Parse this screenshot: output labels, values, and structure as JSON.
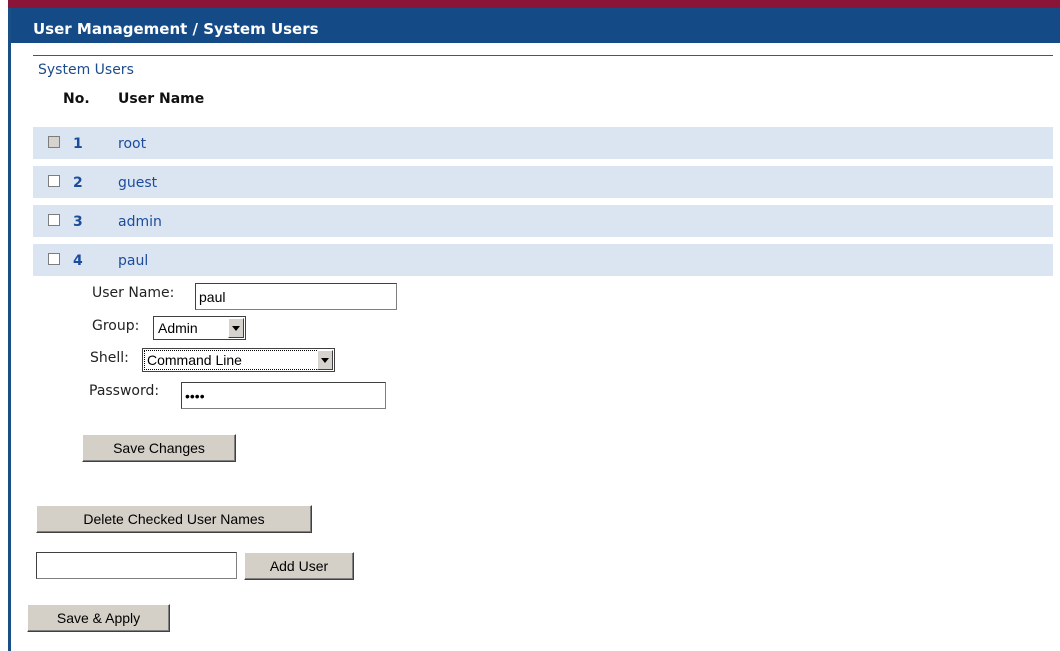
{
  "header": {
    "title": "User Management / System Users"
  },
  "section": {
    "title": "System Users"
  },
  "table": {
    "col_no": "No.",
    "col_user": "User Name",
    "rows": [
      {
        "no": "1",
        "name": "root",
        "checkbox_disabled": true
      },
      {
        "no": "2",
        "name": "guest",
        "checkbox_disabled": false
      },
      {
        "no": "3",
        "name": "admin",
        "checkbox_disabled": false
      },
      {
        "no": "4",
        "name": "paul",
        "checkbox_disabled": false
      }
    ]
  },
  "edit_form": {
    "username_label": "User Name:",
    "username_value": "paul",
    "group_label": "Group:",
    "group_value": "Admin",
    "shell_label": "Shell:",
    "shell_value": "Command Line",
    "password_label": "Password:",
    "password_value": "****",
    "save_changes_label": "Save Changes"
  },
  "actions": {
    "delete_checked_label": "Delete Checked User Names",
    "new_user_value": "",
    "add_user_label": "Add User",
    "save_apply_label": "Save & Apply"
  },
  "colors": {
    "header_bg": "#144a86",
    "top_accent": "#8a1538",
    "row_bg": "#dbe5f1",
    "link_blue": "#1c4c9c"
  }
}
